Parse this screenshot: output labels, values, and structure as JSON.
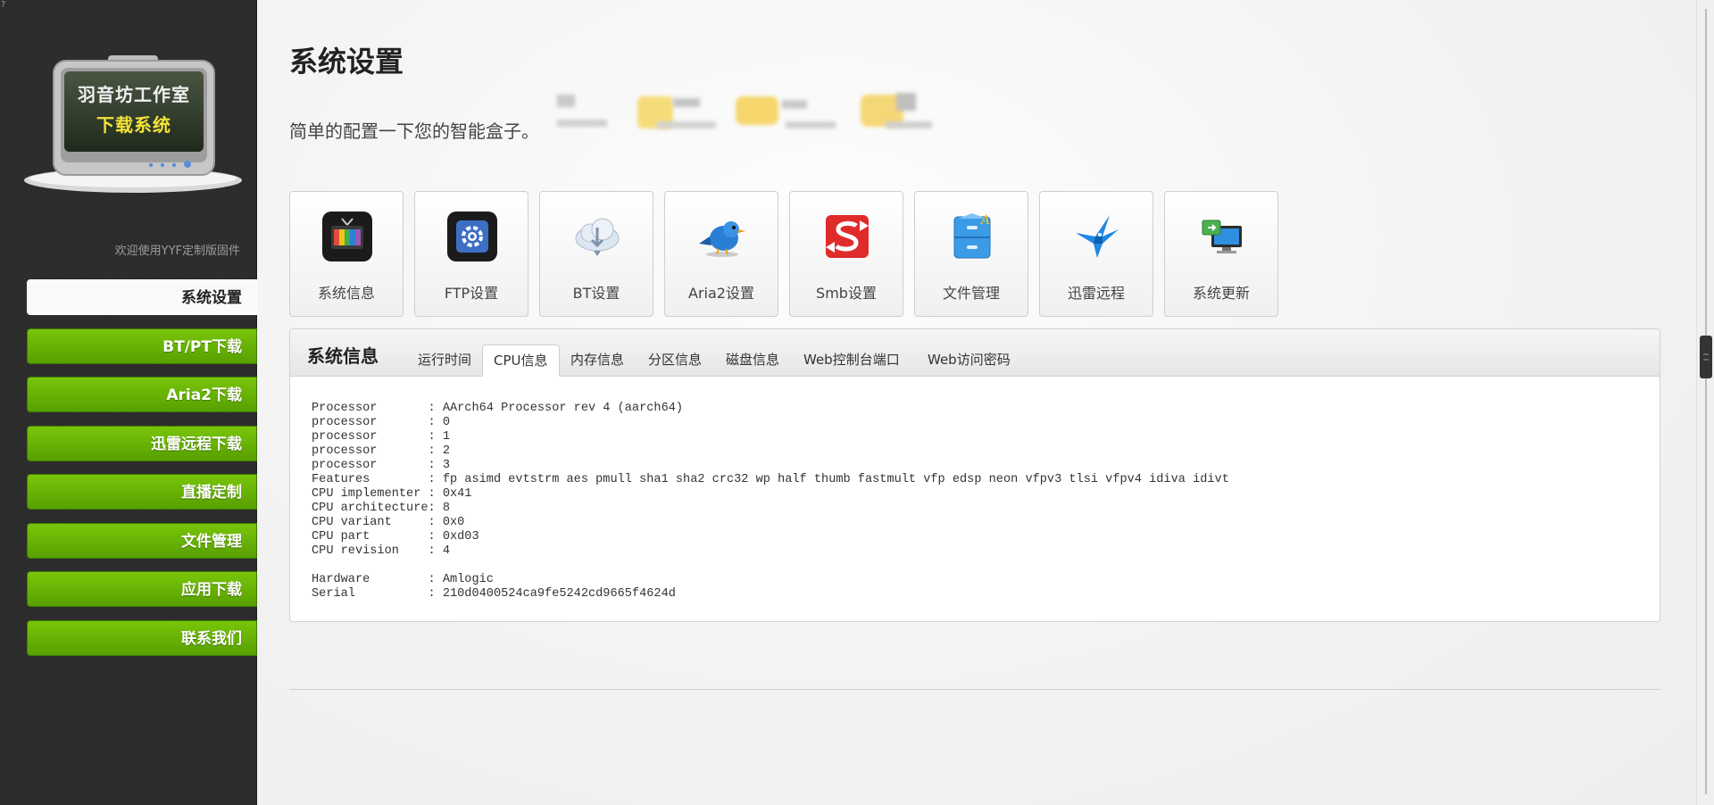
{
  "sidebar": {
    "corner_mark": "?",
    "logo": {
      "line1": "羽音坊工作室",
      "line2": "下载系统"
    },
    "tagline": "欢迎使用YYF定制版固件",
    "items": [
      {
        "label": "系统设置",
        "active": true
      },
      {
        "label": "BT/PT下载",
        "active": false
      },
      {
        "label": "Aria2下载",
        "active": false
      },
      {
        "label": "迅雷远程下载",
        "active": false
      },
      {
        "label": "直播定制",
        "active": false
      },
      {
        "label": "文件管理",
        "active": false
      },
      {
        "label": "应用下载",
        "active": false
      },
      {
        "label": "联系我们",
        "active": false
      }
    ]
  },
  "header": {
    "title": "系统设置",
    "subtitle": "简单的配置一下您的智能盒子。"
  },
  "tiles": [
    {
      "label": "系统信息",
      "icon": "tv-icon"
    },
    {
      "label": "FTP设置",
      "icon": "gear-icon"
    },
    {
      "label": "BT设置",
      "icon": "cloud-download-icon"
    },
    {
      "label": "Aria2设置",
      "icon": "bird-icon"
    },
    {
      "label": "Smb设置",
      "icon": "samba-icon"
    },
    {
      "label": "文件管理",
      "icon": "file-cabinet-icon"
    },
    {
      "label": "迅雷远程",
      "icon": "thunder-bird-icon"
    },
    {
      "label": "系统更新",
      "icon": "monitor-update-icon"
    }
  ],
  "panel": {
    "title": "系统信息",
    "tabs": [
      {
        "label": "运行时间",
        "active": false
      },
      {
        "label": "CPU信息",
        "active": true
      },
      {
        "label": "内存信息",
        "active": false
      },
      {
        "label": "分区信息",
        "active": false
      },
      {
        "label": "磁盘信息",
        "active": false
      },
      {
        "label": "Web控制台端口",
        "active": false
      },
      {
        "label": "Web访问密码",
        "active": false
      }
    ],
    "cpu_info": "Processor       : AArch64 Processor rev 4 (aarch64)\nprocessor       : 0\nprocessor       : 1\nprocessor       : 2\nprocessor       : 3\nFeatures        : fp asimd evtstrm aes pmull sha1 sha2 crc32 wp half thumb fastmult vfp edsp neon vfpv3 tlsi vfpv4 idiva idivt\nCPU implementer : 0x41\nCPU architecture: 8\nCPU variant     : 0x0\nCPU part        : 0xd03\nCPU revision    : 4\n\nHardware        : Amlogic\nSerial          : 210d0400524ca9fe5242cd9665f4624d"
  },
  "colors": {
    "sidebar_bg": "#2b2b2b",
    "nav_green": "#62b000",
    "nav_active_bg": "#fafafa"
  }
}
